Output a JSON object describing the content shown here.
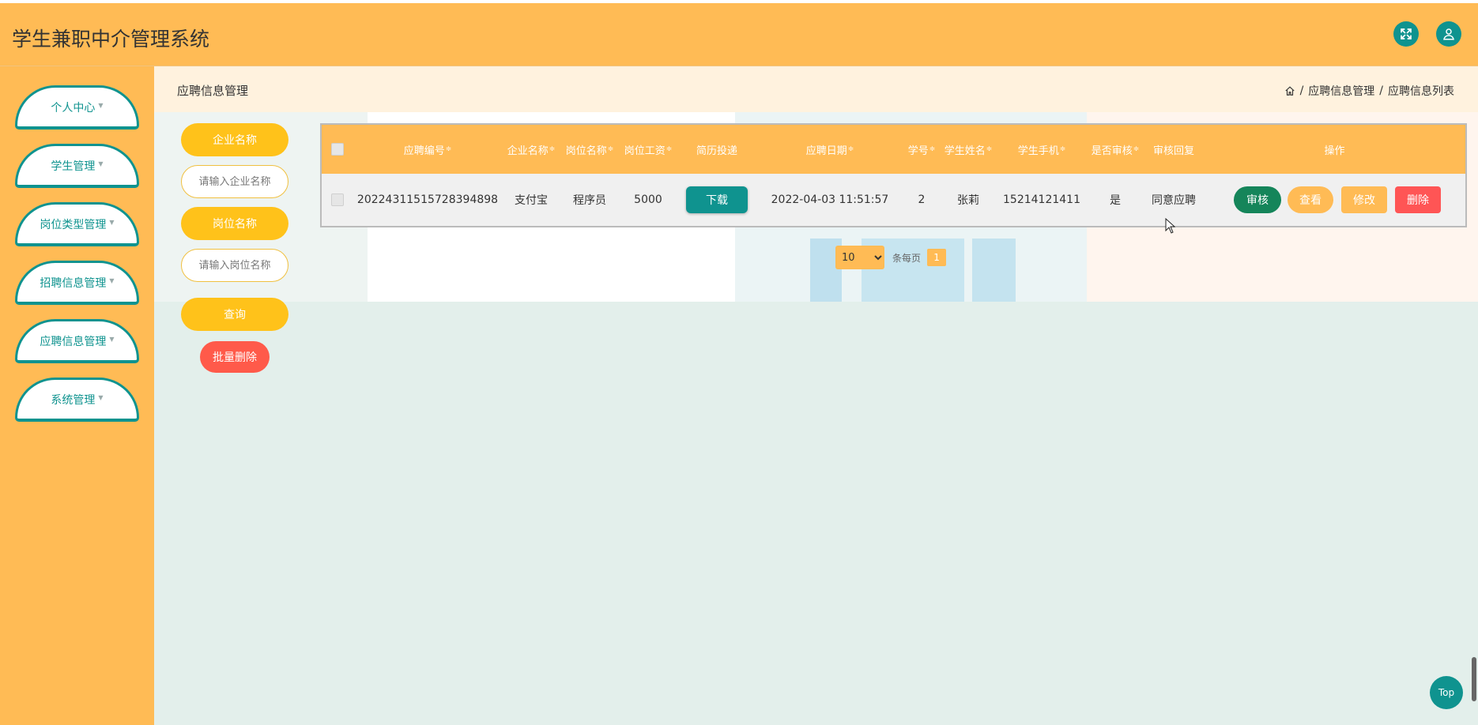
{
  "header": {
    "title": "学生兼职中介管理系统",
    "fullscreen_icon": "expand-icon",
    "user_icon": "user-icon"
  },
  "sidebar": {
    "items": [
      {
        "label": "个人中心"
      },
      {
        "label": "学生管理"
      },
      {
        "label": "岗位类型管理"
      },
      {
        "label": "招聘信息管理"
      },
      {
        "label": "应聘信息管理"
      },
      {
        "label": "系统管理"
      }
    ],
    "caret": "▼"
  },
  "page": {
    "title": "应聘信息管理",
    "breadcrumb": [
      "应聘信息管理",
      "应聘信息列表"
    ],
    "breadcrumb_sep": "/"
  },
  "search": {
    "company_label": "企业名称",
    "company_placeholder": "请输入企业名称",
    "position_label": "岗位名称",
    "position_placeholder": "请输入岗位名称",
    "query_label": "查询",
    "batch_delete_label": "批量删除"
  },
  "table": {
    "sort_icon": "≑",
    "columns": [
      {
        "label": "应聘编号",
        "sortable": true
      },
      {
        "label": "企业名称",
        "sortable": true
      },
      {
        "label": "岗位名称",
        "sortable": true
      },
      {
        "label": "岗位工资",
        "sortable": true
      },
      {
        "label": "简历投递",
        "sortable": false
      },
      {
        "label": "应聘日期",
        "sortable": true
      },
      {
        "label": "学号",
        "sortable": true
      },
      {
        "label": "学生姓名",
        "sortable": true
      },
      {
        "label": "学生手机",
        "sortable": true
      },
      {
        "label": "是否审核",
        "sortable": true
      },
      {
        "label": "审核回复",
        "sortable": false
      },
      {
        "label": "操作",
        "sortable": false
      }
    ],
    "rows": [
      {
        "id": "20224311515728394898",
        "company": "支付宝",
        "position": "程序员",
        "salary": "5000",
        "resume_button": "下载",
        "date": "2022-04-03 11:51:57",
        "student_no": "2",
        "student_name": "张莉",
        "phone": "15214121411",
        "reviewed": "是",
        "reply": "同意应聘",
        "actions": {
          "audit": "审核",
          "view": "查看",
          "edit": "修改",
          "delete": "删除"
        }
      }
    ]
  },
  "pagination": {
    "page_size": "10",
    "page_size_options": [
      "10"
    ],
    "per_page_label": "条每页",
    "current_page": "1"
  },
  "top_button": "Top",
  "colors": {
    "primary": "#0f938f",
    "accent": "#ffbb55",
    "danger": "#ff5555"
  }
}
